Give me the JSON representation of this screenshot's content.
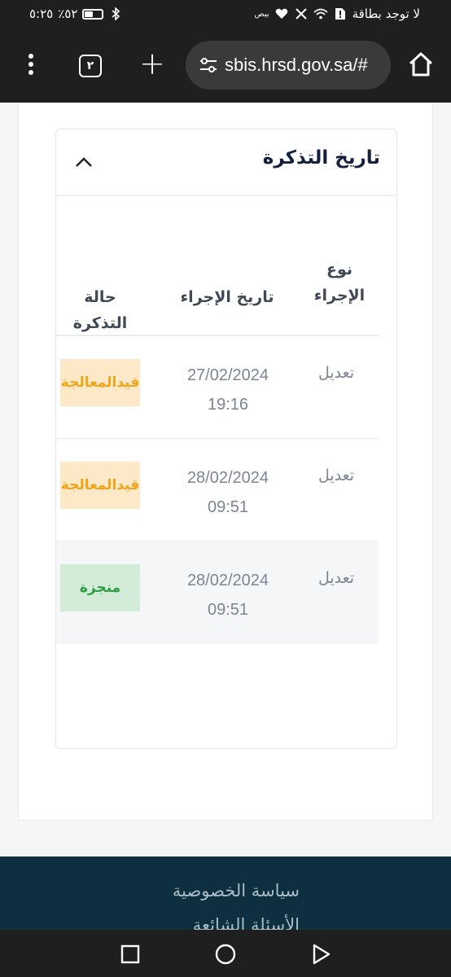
{
  "status_bar": {
    "time": "٥:٢٥",
    "battery_percent": "٪٥٢",
    "battery_level": 0.52,
    "carrier_text": "لا توجد بطاقة",
    "small_label": "ببص"
  },
  "browser": {
    "tab_count": "٢",
    "url": "sbis.hrsd.gov.sa/#"
  },
  "card": {
    "title": "تاريخ التذكرة"
  },
  "table": {
    "headers": {
      "type_line1": "نوع",
      "type_line2": "الإجراء",
      "date": "تاريخ الإجراء",
      "status": "حالة التذكرة"
    },
    "rows": [
      {
        "type": "تعديل",
        "date": "27/02/2024",
        "time": "19:16",
        "status": "قيدالمعالجة"
      },
      {
        "type": "تعديل",
        "date": "28/02/2024",
        "time": "09:51",
        "status": "قيدالمعالجة"
      },
      {
        "type": "تعديل",
        "date": "28/02/2024",
        "time": "09:51",
        "status": "منجزة"
      }
    ]
  },
  "footer": {
    "link_privacy": "سياسة الخصوصية",
    "link_faq": "الأسئلة الشائعة"
  },
  "colors": {
    "pending_bg": "#fde9c7",
    "pending_text": "#f2a51a",
    "done_bg": "#d2ecd7",
    "done_text": "#2a9d3e",
    "footer_bg": "#0e2f40"
  }
}
